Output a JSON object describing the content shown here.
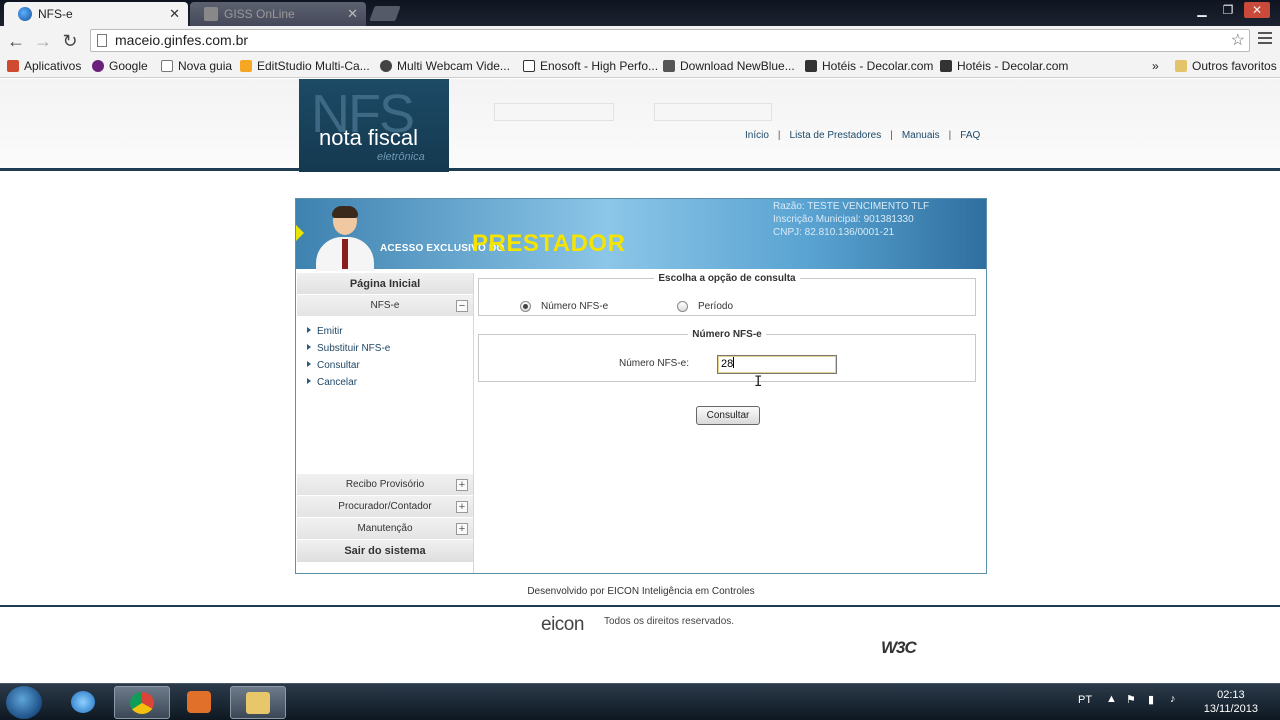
{
  "browser": {
    "tabs": [
      {
        "title": "NFS-e",
        "active": true
      },
      {
        "title": "GISS OnLine",
        "active": false
      }
    ],
    "url": "maceio.ginfes.com.br",
    "bookmarks": [
      {
        "label": "Aplicativos",
        "icon": "apps-grid-icon",
        "color": "#d04a30"
      },
      {
        "label": "Google",
        "icon": "yahoo-icon",
        "color": "#6a1f7a"
      },
      {
        "label": "Nova guia",
        "icon": "page-icon",
        "color": "#ffffff"
      },
      {
        "label": "EditStudio Multi-Ca...",
        "icon": "editstudio-icon",
        "color": "#f5a623"
      },
      {
        "label": "Multi Webcam Vide...",
        "icon": "webcam-icon",
        "color": "#444444"
      },
      {
        "label": "Enosoft - High Perfo...",
        "icon": "enosoft-icon",
        "color": "#ffffff"
      },
      {
        "label": "Download NewBlue...",
        "icon": "fx-icon",
        "color": "#555555"
      },
      {
        "label": "Hotéis - Decolar.com",
        "icon": "decolar-icon",
        "color": "#333333"
      },
      {
        "label": "Hotéis - Decolar.com",
        "icon": "decolar-icon",
        "color": "#333333"
      }
    ],
    "more": "»",
    "other_bookmarks": "Outros favoritos"
  },
  "header": {
    "logo_big": "NFS",
    "logo_line": "nota fiscal",
    "logo_small": "eletrônica",
    "nav": [
      "Início",
      "Lista de Prestadores",
      "Manuais",
      "FAQ"
    ]
  },
  "banner": {
    "access_text": "ACESSO EXCLUSIVO DO",
    "role_text": "PRESTADOR",
    "razao": "Razão: TESTE VENCIMENTO TLF",
    "inscricao": "Inscrição Municipal: 901381330",
    "cnpj": "CNPJ: 82.810.136/0001-21"
  },
  "sidebar": {
    "home": "Página Inicial",
    "nfse_section": "NFS-e",
    "nfse_items": [
      "Emitir",
      "Substituir NFS-e",
      "Consultar",
      "Cancelar"
    ],
    "collapsed_sections": [
      "Recibo Provisório",
      "Procurador/Contador",
      "Manutenção"
    ],
    "exit": "Sair do sistema",
    "minus": "−",
    "plus": "+"
  },
  "consulta": {
    "option_legend": "Escolha a opção de consulta",
    "options": [
      {
        "label": "Número NFS-e",
        "selected": true
      },
      {
        "label": "Período",
        "selected": false
      }
    ],
    "numero_legend": "Número NFS-e",
    "field_label": "Número NFS-e:",
    "field_value": "28",
    "button": "Consultar"
  },
  "footer": {
    "developed_by": "Desenvolvido por EICON Inteligência em Controles",
    "eicon_logo": "eicon",
    "rights": "Todos os direitos reservados.",
    "w3c": "W3C"
  },
  "taskbar": {
    "lang": "PT",
    "time": "02:13",
    "date": "13/11/2013"
  }
}
